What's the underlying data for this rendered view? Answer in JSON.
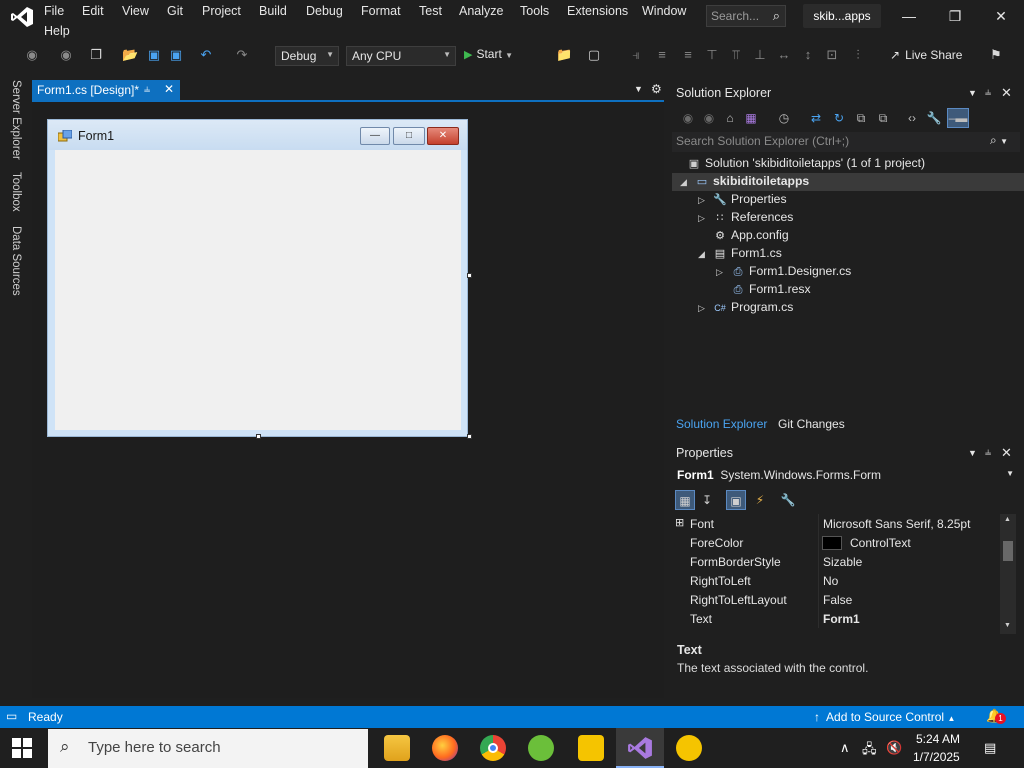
{
  "menu": {
    "items": [
      "File",
      "Edit",
      "View",
      "Git",
      "Project",
      "Build",
      "Debug",
      "Format",
      "Test",
      "Analyze",
      "Tools",
      "Extensions",
      "Window",
      "Help"
    ],
    "search_placeholder": "Search...",
    "solution_badge": "skib...apps"
  },
  "toolbar": {
    "config": "Debug",
    "platform": "Any CPU",
    "start_label": "Start",
    "live_share": "Live Share"
  },
  "side_tabs": [
    "Server Explorer",
    "Toolbox",
    "Data Sources"
  ],
  "document": {
    "tab_label": "Form1.cs [Design]*",
    "form_title": "Form1"
  },
  "solution_explorer": {
    "title": "Solution Explorer",
    "search_placeholder": "Search Solution Explorer (Ctrl+;)",
    "tree": [
      {
        "label": "Solution 'skibiditoiletapps' (1 of 1 project)",
        "icon": "solution-icon",
        "bold": false
      },
      {
        "label": "skibiditoiletapps",
        "icon": "csharp-project-icon",
        "bold": true
      },
      {
        "label": "Properties",
        "icon": "wrench-icon",
        "bold": false
      },
      {
        "label": "References",
        "icon": "references-icon",
        "bold": false
      },
      {
        "label": "App.config",
        "icon": "config-file-icon",
        "bold": false
      },
      {
        "label": "Form1.cs",
        "icon": "form-icon",
        "bold": false
      },
      {
        "label": "Form1.Designer.cs",
        "icon": "cs-file-icon",
        "bold": false
      },
      {
        "label": "Form1.resx",
        "icon": "resx-file-icon",
        "bold": false
      },
      {
        "label": "Program.cs",
        "icon": "cs-file-icon",
        "bold": false
      }
    ],
    "tabs": [
      "Solution Explorer",
      "Git Changes"
    ]
  },
  "properties": {
    "title": "Properties",
    "object_name": "Form1",
    "object_type": "System.Windows.Forms.Form",
    "rows": [
      {
        "name": "Font",
        "value": "Microsoft Sans Serif, 8.25pt",
        "bold": false
      },
      {
        "name": "ForeColor",
        "value": "ControlText",
        "bold": false
      },
      {
        "name": "FormBorderStyle",
        "value": "Sizable",
        "bold": false
      },
      {
        "name": "RightToLeft",
        "value": "No",
        "bold": false
      },
      {
        "name": "RightToLeftLayout",
        "value": "False",
        "bold": false
      },
      {
        "name": "Text",
        "value": "Form1",
        "bold": true
      }
    ],
    "desc_title": "Text",
    "desc_text": "The text associated with the control."
  },
  "status": {
    "ready": "Ready",
    "source_control": "Add to Source Control",
    "notification_count": "1"
  },
  "taskbar": {
    "search_placeholder": "Type here to search",
    "time": "5:24 AM",
    "date": "1/7/2025"
  },
  "colors": {
    "accent": "#0078d4",
    "tab_active": "#0e70c0",
    "ide_bg": "#1f1f1f",
    "form_client": "#f0f0f0"
  }
}
